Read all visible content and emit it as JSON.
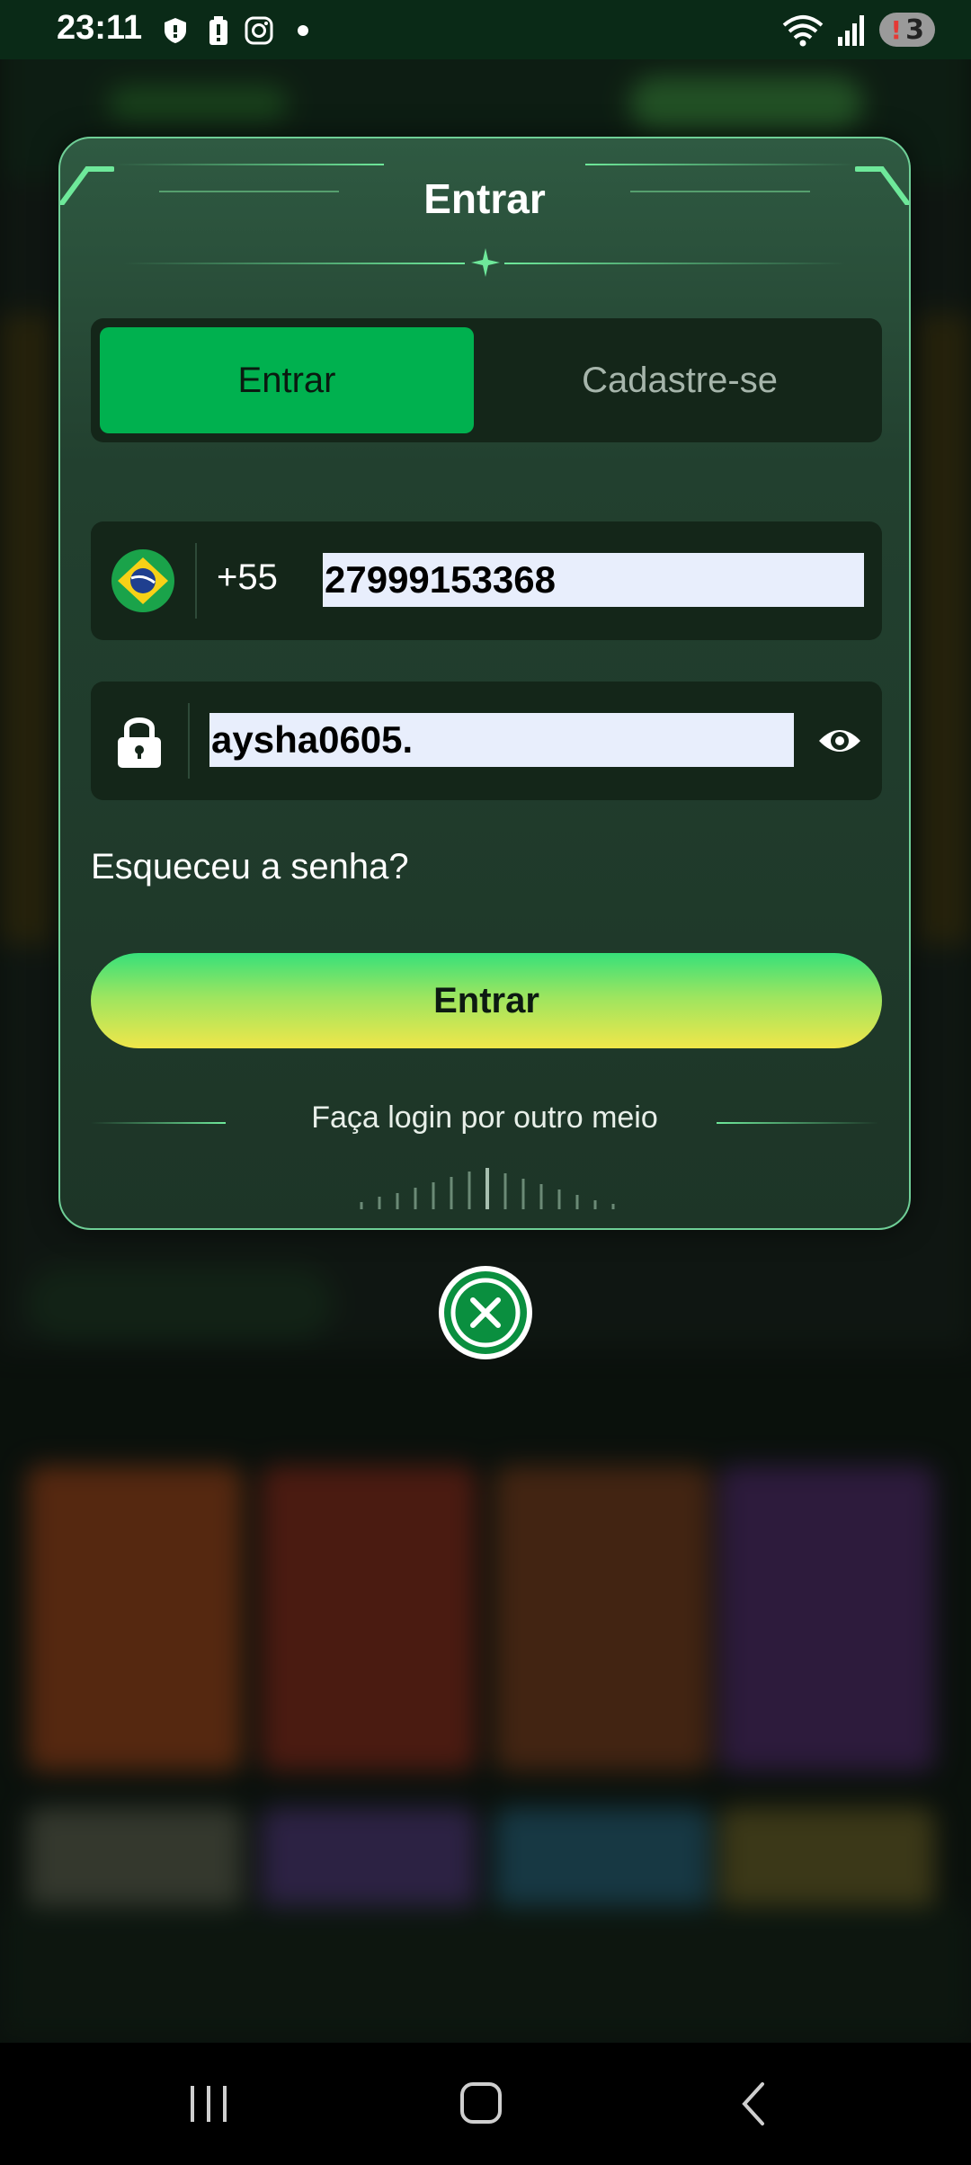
{
  "status_bar": {
    "time": "23:11",
    "notification_count": "3",
    "icons": [
      "shield-icon",
      "battery-alert-icon",
      "instagram-icon",
      "dot-icon",
      "wifi-icon",
      "signal-icon"
    ]
  },
  "login_modal": {
    "title": "Entrar",
    "tabs": [
      {
        "label": "Entrar",
        "active": true
      },
      {
        "label": "Cadastre-se",
        "active": false
      }
    ],
    "phone": {
      "country_code": "+55",
      "value": "27999153368",
      "flag": "brazil-flag"
    },
    "password": {
      "value": "aysha0605.",
      "visibility_icon": "eye-icon"
    },
    "forgot_password": "Esqueceu a senha?",
    "submit_label": "Entrar",
    "alt_login_label": "Faça login por outro meio"
  },
  "colors": {
    "accent_green": "#00b14f",
    "modal_border": "#6fcf97",
    "button_gradient_top": "#37e07a",
    "button_gradient_bottom": "#f0e64a"
  }
}
